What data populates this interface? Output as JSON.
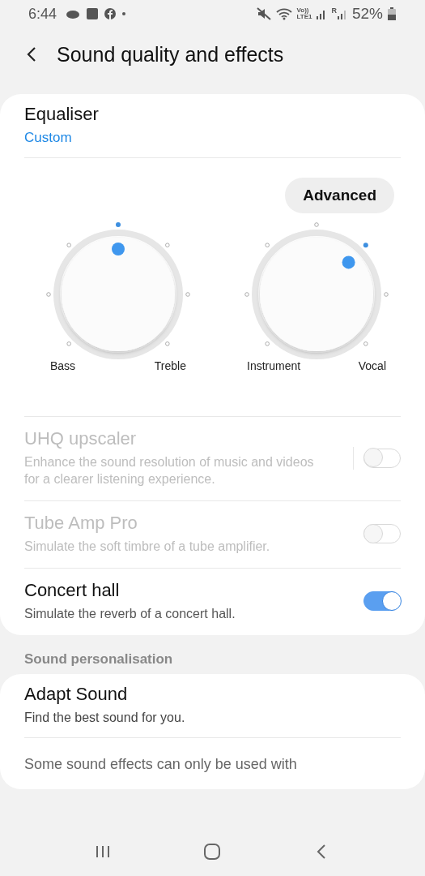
{
  "status_bar": {
    "time": "6:44",
    "volte_top": "Vo))",
    "volte_bottom": "LTE1",
    "roaming": "R",
    "battery_text": "52%"
  },
  "header": {
    "title": "Sound quality and effects"
  },
  "equaliser": {
    "title": "Equaliser",
    "value": "Custom",
    "advanced_button": "Advanced"
  },
  "knobs": [
    {
      "left_label": "Bass",
      "right_label": "Treble"
    },
    {
      "left_label": "Instrument",
      "right_label": "Vocal"
    }
  ],
  "settings": [
    {
      "title": "UHQ upscaler",
      "description": "Enhance the sound resolution of music and videos for a clearer listening experience.",
      "on": false,
      "disabled": true,
      "divider": true
    },
    {
      "title": "Tube Amp Pro",
      "description": "Simulate the soft timbre of a tube amplifier.",
      "on": false,
      "disabled": true,
      "divider": false
    },
    {
      "title": "Concert hall",
      "description": "Simulate the reverb of a concert hall.",
      "on": true,
      "disabled": false,
      "divider": false
    }
  ],
  "section_header": "Sound personalisation",
  "personalisation": {
    "title": "Adapt Sound",
    "description": "Find the best sound for you.",
    "note": "Some sound effects can only be used with"
  }
}
